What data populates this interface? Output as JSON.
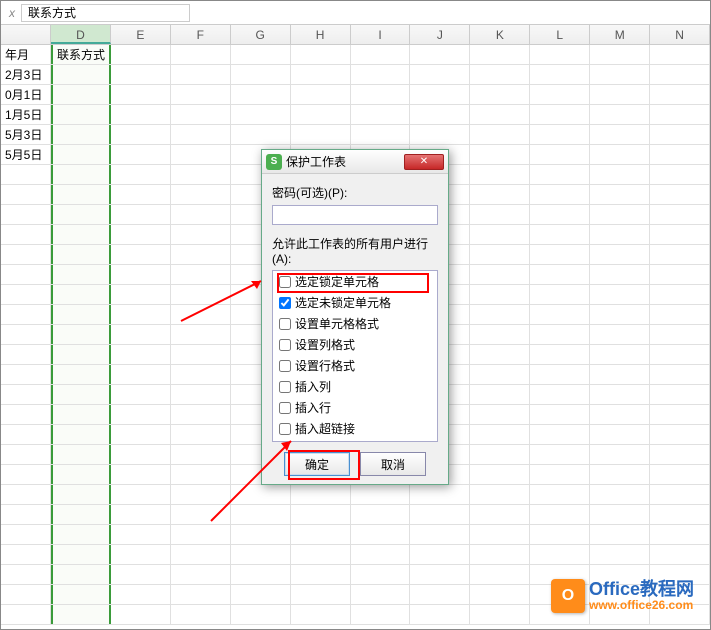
{
  "formula_bar": {
    "fx": "x",
    "value": "联系方式"
  },
  "columns": [
    "D",
    "E",
    "F",
    "G",
    "H",
    "I",
    "J",
    "K",
    "L",
    "M",
    "N"
  ],
  "selected_column": "D",
  "row_headers": [
    "年月",
    "2月3日",
    "0月1日",
    "1月5日",
    "5月3日",
    "5月5日"
  ],
  "header_cell": "联系方式",
  "dialog": {
    "title": "保护工作表",
    "password_label": "密码(可选)(P):",
    "perm_label": "允许此工作表的所有用户进行(A):",
    "options": [
      {
        "label": "选定锁定单元格",
        "checked": false
      },
      {
        "label": "选定未锁定单元格",
        "checked": true
      },
      {
        "label": "设置单元格格式",
        "checked": false
      },
      {
        "label": "设置列格式",
        "checked": false
      },
      {
        "label": "设置行格式",
        "checked": false
      },
      {
        "label": "插入列",
        "checked": false
      },
      {
        "label": "插入行",
        "checked": false
      },
      {
        "label": "插入超链接",
        "checked": false
      }
    ],
    "ok": "确定",
    "cancel": "取消"
  },
  "watermark": {
    "brand": "Office教程网",
    "url": "www.office26.com",
    "icon_letter": "O"
  }
}
